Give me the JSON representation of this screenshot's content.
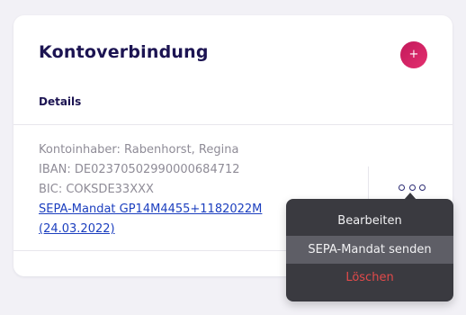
{
  "card": {
    "title": "Kontoverbindung",
    "add_button_label": "+",
    "section_label": "Details"
  },
  "account": {
    "holder": "Kontoinhaber: Rabenhorst, Regina",
    "iban": "IBAN: DE02370502990000684712",
    "bic": "BIC: COKSDE33XXX",
    "mandate_link_line1": "SEPA-Mandat GP14M4455+1182022M",
    "mandate_link_line2": "(24.03.2022)"
  },
  "menu": {
    "items": [
      {
        "label": "Bearbeiten",
        "state": "normal"
      },
      {
        "label": "SEPA-Mandat senden",
        "state": "hover"
      },
      {
        "label": "Löschen",
        "state": "danger"
      }
    ]
  },
  "colors": {
    "accent_gradient_start": "#c2185b",
    "accent_gradient_end": "#e4306f",
    "title": "#1c1452",
    "link": "#1c3fbf",
    "danger": "#e24a4a",
    "menu_bg": "#3a3a40"
  },
  "icons": {
    "more": "more-horizontal-icon"
  }
}
